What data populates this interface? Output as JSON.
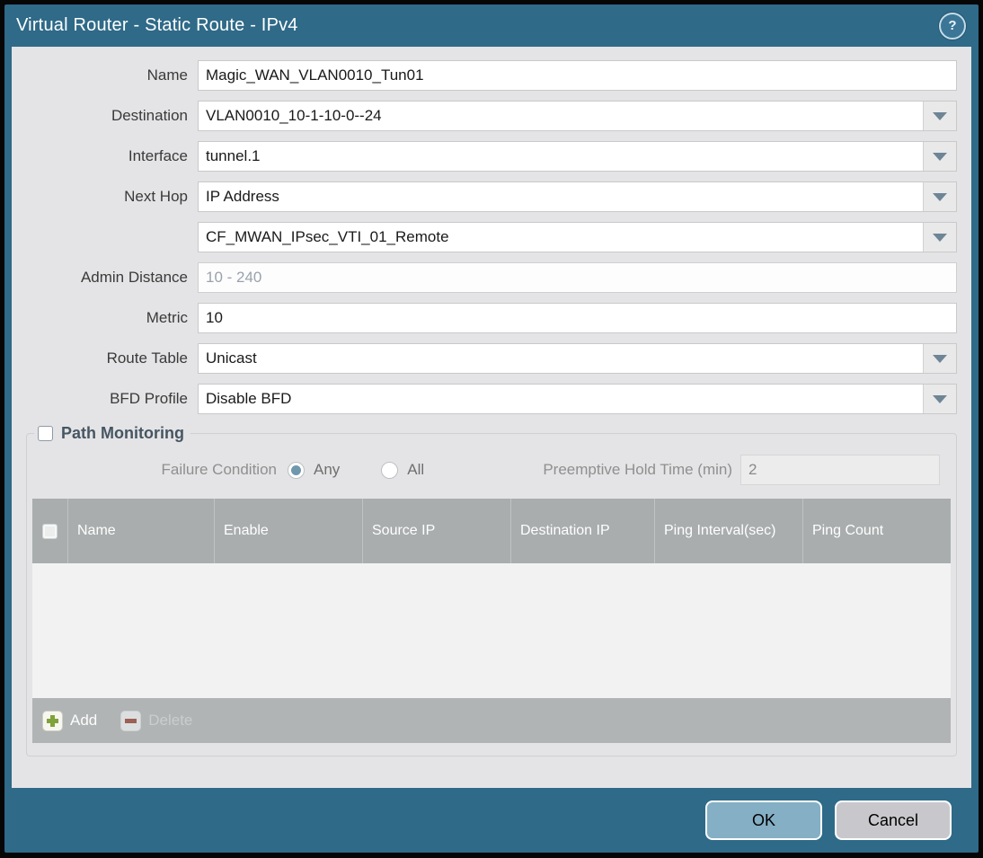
{
  "dialog": {
    "title": "Virtual Router - Static Route - IPv4",
    "help_icon": "?"
  },
  "form": {
    "name": {
      "label": "Name",
      "value": "Magic_WAN_VLAN0010_Tun01"
    },
    "destination": {
      "label": "Destination",
      "value": "VLAN0010_10-1-10-0--24"
    },
    "interface": {
      "label": "Interface",
      "value": "tunnel.1"
    },
    "next_hop": {
      "label": "Next Hop",
      "value": "IP Address"
    },
    "next_hop_address": {
      "value": "CF_MWAN_IPsec_VTI_01_Remote"
    },
    "admin_distance": {
      "label": "Admin Distance",
      "placeholder": "10 - 240",
      "value": ""
    },
    "metric": {
      "label": "Metric",
      "value": "10"
    },
    "route_table": {
      "label": "Route Table",
      "value": "Unicast"
    },
    "bfd_profile": {
      "label": "BFD Profile",
      "value": "Disable BFD"
    }
  },
  "path_monitoring": {
    "section_label": "Path Monitoring",
    "checkbox_checked": false,
    "failure_condition_label": "Failure Condition",
    "radio_any_label": "Any",
    "radio_all_label": "All",
    "radio_selected": "Any",
    "preemptive_label": "Preemptive Hold Time (min)",
    "preemptive_value": "2",
    "table": {
      "headers": [
        "Name",
        "Enable",
        "Source IP",
        "Destination IP",
        "Ping Interval(sec)",
        "Ping Count"
      ],
      "rows": []
    },
    "add_label": "Add",
    "delete_label": "Delete",
    "delete_enabled": false
  },
  "footer": {
    "ok_label": "OK",
    "cancel_label": "Cancel"
  },
  "colors": {
    "title_bar": "#2f6a88",
    "content_bg": "#e4e4e6",
    "table_header_bg": "#a9adae",
    "table_footer_bg": "#b0b4b5",
    "ok_button": "#84afc5",
    "cancel_button": "#c8c8cc",
    "add_plus_green": "#7fa33a",
    "delete_minus_red": "#9c6055",
    "radio_selected_fill": "#6f98ae"
  }
}
